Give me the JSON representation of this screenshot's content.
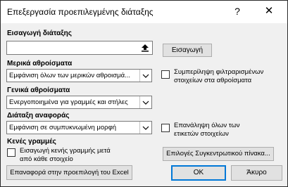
{
  "title": "Επεξεργασία προεπιλεγμένης διάταξης",
  "help_label": "?",
  "close_label": "✕",
  "import_section": {
    "label": "Εισαγωγή διάταξης",
    "input_value": "",
    "import_button": "Εισαγωγή"
  },
  "subtotals": {
    "label": "Μερικά αθροίσματα",
    "selected": "Εμφάνιση όλων των μερικών αθροισμά...",
    "checkbox_label": "Συμπερίληψη φιλτραρισμένων στοιχείων στα αθροίσματα"
  },
  "grand_totals": {
    "label": "Γενικά αθροίσματα",
    "selected": "Ενεργοποιημένα για γραμμές και στήλες"
  },
  "report_layout": {
    "label": "Διάταξη αναφοράς",
    "selected": "Εμφάνιση σε συμπυκνωμένη μορφή",
    "checkbox_label": "Επανάληψη όλων των ετικετών στοιχείων"
  },
  "blank_rows": {
    "label": "Κενές γραμμές",
    "checkbox_label": "Εισαγωγή κενής γραμμής μετά από κάθε στοιχείο"
  },
  "buttons": {
    "pivot_options": "Επιλογές Συγκεντρωτικού πίνακα...",
    "reset": "Επαναφορά στην προεπιλογή του Excel",
    "ok": "OK",
    "cancel": "Άκυρο"
  }
}
